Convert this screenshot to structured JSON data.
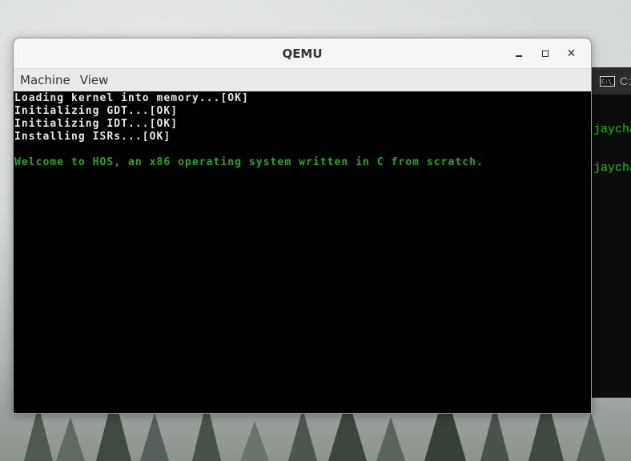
{
  "qemu": {
    "title": "QEMU",
    "menu": [
      "Machine",
      "View"
    ],
    "controls": {
      "minimize_icon": "minimize-icon",
      "maximize_icon": "maximize-icon",
      "close_icon": "close-icon",
      "close_glyph": "✕"
    },
    "screen": {
      "boot_lines": [
        "Loading kernel into memory...[OK]",
        "Initializing GDT...[OK]",
        "Initializing IDT...[OK]",
        "Installing ISRs...[OK]"
      ],
      "welcome_line": "Welcome to HOS, an x86 operating system written in C from scratch.",
      "text_color": "#e8e8e8",
      "welcome_color": "#1fa91f",
      "background_color": "#000000"
    }
  },
  "console": {
    "title": "C:\\",
    "icon_text": "C:\\_",
    "lines": [
      "jaycha",
      "jaycha"
    ],
    "text_color": "#16c60c"
  }
}
